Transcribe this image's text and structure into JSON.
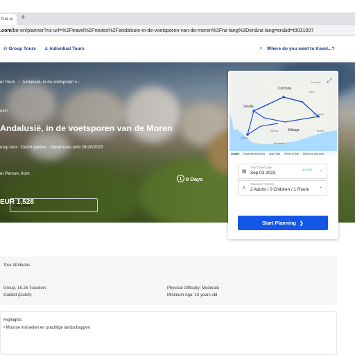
{
  "browser": {
    "tab_title": "ft.re",
    "new_tab": "+",
    "url_domain": ".com",
    "url_rest": "/be-en/planner?nz-url=%2Ftravel%2Froutes%2Fandalusie-in-de-voetsporen-van-de-moren%3Fnz-lang%3Den&nz-lang=en&id=t0031007"
  },
  "header": {
    "group_tours": "Group Tours",
    "individual_tours": "Individual Tours",
    "search_placeholder": "Where do you want to travel...?"
  },
  "hero": {
    "breadcrumb_parent": "ur Tours",
    "breadcrumb_sep": "/",
    "breadcrumb_current": "Andalusië, in de voetsporen v...",
    "country": "pain",
    "title": "Andalusië, in de voetsporen van de Moren",
    "subtitle": "roup tour - Dutch guided - Departures until 28/10/2023",
    "price_label": "er Person, from",
    "price": "EUR 1,528",
    "duration": "8 Days"
  },
  "map": {
    "cities": {
      "cordoba": "Córdoba",
      "seville": "Seville",
      "granada": "Granada",
      "malaga": "Málaga",
      "linares": "Linares",
      "jaen": "Jaén",
      "motril": "Motril",
      "marbella": "Marbella",
      "cadiz": "Cádiz",
      "osuna": "Osuna"
    },
    "footer": [
      "Keyboard shortcuts",
      "Map Data",
      "Terms of Use",
      "Report a map error"
    ],
    "google": "Google"
  },
  "planner": {
    "travel_date_label": "Your Travel Date",
    "travel_date": "Sep 03 2023",
    "co2": "0.0",
    "travelers_label": "Travelers / Rooms",
    "travelers": "2 Adults / 0 Children / 1 Room",
    "room_type": "Standard",
    "start_button": "Start Planning"
  },
  "attributes": {
    "heading": "Tour Attributes",
    "group": "Group, 15-25 Travelers",
    "guided": "Guided (Dutch)",
    "difficulty": "Physical Difficulty: Moderate",
    "min_age": "Minimum Age: 10 years old"
  },
  "highlights": {
    "heading": "Highlights",
    "items": [
      "Moorse invloeden en prachtige landschappen"
    ]
  },
  "colors": {
    "brand_blue": "#1a3a8f",
    "button_blue": "#1457e6",
    "route_blue": "#1f4fd6"
  }
}
